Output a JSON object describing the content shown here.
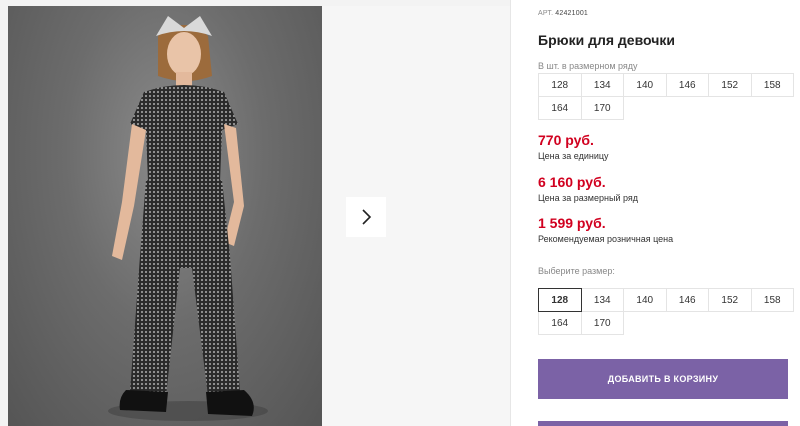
{
  "product": {
    "article_label": "АРТ.",
    "article_value": "42421001",
    "title": "Брюки для девочки"
  },
  "size_range": {
    "hint": "В шт. в размерном ряду",
    "sizes": [
      "128",
      "134",
      "140",
      "146",
      "152",
      "158",
      "164",
      "170"
    ]
  },
  "prices": [
    {
      "value": "770 руб.",
      "label": "Цена за единицу"
    },
    {
      "value": "6 160 руб.",
      "label": "Цена за размерный ряд"
    },
    {
      "value": "1 599 руб.",
      "label": "Рекомендуемая розничная цена"
    }
  ],
  "size_select": {
    "label": "Выберите размер:",
    "selected": "128",
    "sizes": [
      "128",
      "134",
      "140",
      "146",
      "152",
      "158",
      "164",
      "170"
    ]
  },
  "cart": {
    "add_label": "ДОБАВИТЬ В КОРЗИНУ"
  },
  "gallery": {
    "next_icon": "chevron-right-icon"
  },
  "colors": {
    "accent": "#7b62a6",
    "price": "#d1001f"
  }
}
